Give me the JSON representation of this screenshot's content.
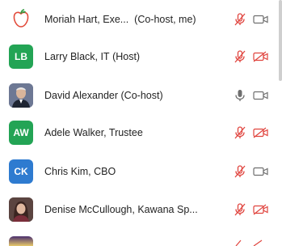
{
  "participants": [
    {
      "name": "Moriah Hart, Exe...",
      "role": "(Co-host, me)",
      "avatar": "logo-apple-icon",
      "mic": "muted",
      "camera": "off-gray"
    },
    {
      "initials": "LB",
      "name": "Larry Black, IT",
      "role": "(Host)",
      "avatar_color": "#23a455",
      "mic": "muted",
      "camera": "off-red"
    },
    {
      "name": "David Alexander",
      "role": "(Co-host)",
      "avatar": "photo",
      "mic": "unmuted",
      "camera": "off-gray"
    },
    {
      "initials": "AW",
      "name": "Adele Walker, Trustee",
      "role": "",
      "avatar_color": "#23a455",
      "mic": "muted",
      "camera": "off-red"
    },
    {
      "initials": "CK",
      "name": "Chris Kim, CBO",
      "role": "",
      "avatar_color": "#2e7bd0",
      "mic": "muted",
      "camera": "off-gray"
    },
    {
      "name": "Denise McCullough, Kawana Sp...",
      "role": "",
      "avatar": "photo",
      "mic": "muted",
      "camera": "off-red"
    }
  ],
  "colors": {
    "muted_red": "#e0443e",
    "icon_gray": "#6f6f6f"
  }
}
